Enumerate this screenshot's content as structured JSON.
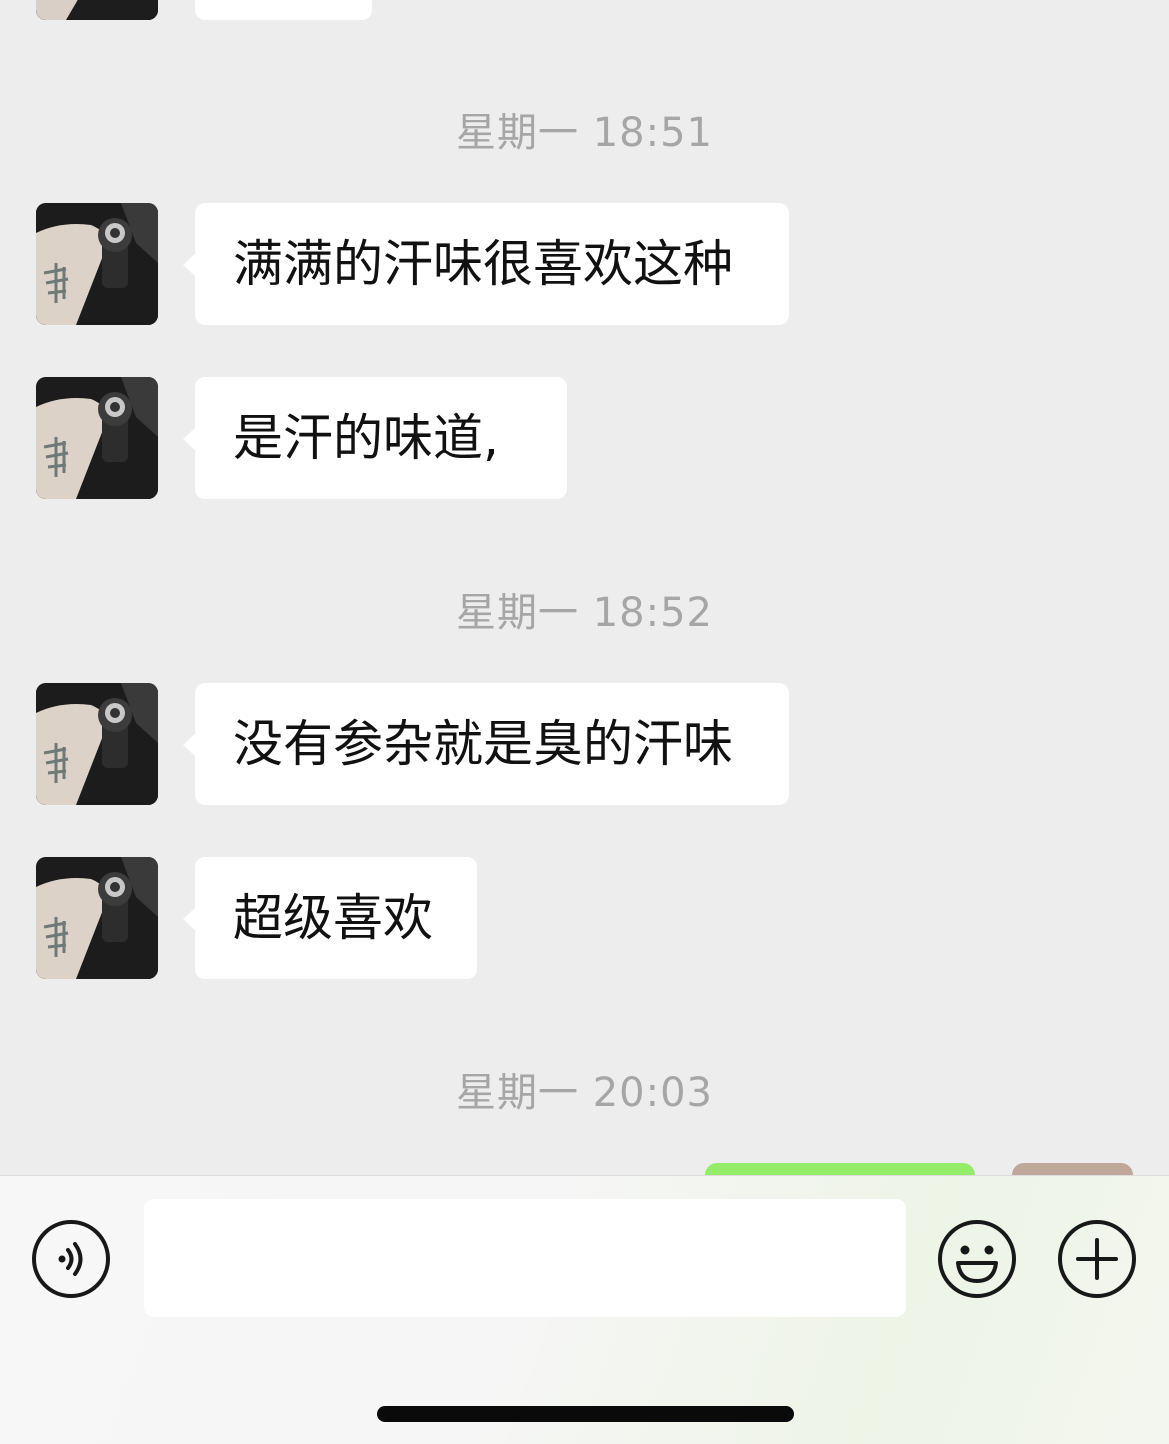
{
  "conversation": {
    "timestamps": [
      "星期一 18:51",
      "星期一 18:52",
      "星期一 20:03"
    ],
    "messages": [
      {
        "sender": "contact",
        "text": "满满的汗味很喜欢这种"
      },
      {
        "sender": "contact",
        "text": "是汗的味道,"
      },
      {
        "sender": "contact",
        "text": "没有参杂就是臭的汗味"
      },
      {
        "sender": "contact",
        "text": "超级喜欢"
      }
    ]
  },
  "input_bar": {
    "text_value": "",
    "voice_icon": "voice-icon",
    "emoji_icon": "emoji-icon",
    "plus_icon": "plus-icon"
  },
  "colors": {
    "chat_background": "#ededed",
    "incoming_bubble": "#ffffff",
    "outgoing_bubble": "#95ec69",
    "timestamp_text": "#a6a6a6"
  }
}
